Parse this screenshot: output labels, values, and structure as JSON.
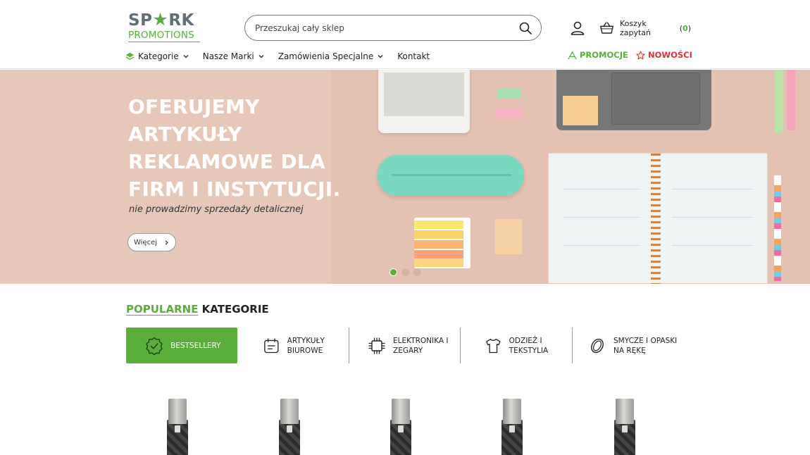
{
  "brand": {
    "logo_top_left": "SP",
    "logo_star": "★",
    "logo_top_right": "RK",
    "logo_bottom": "PROMOTIONS"
  },
  "search": {
    "placeholder": "Przeszukaj cały sklep"
  },
  "cart": {
    "label": "Koszyk zapytań",
    "count": "0"
  },
  "nav": {
    "items": [
      {
        "label": "Kategorie",
        "icon": "layers-icon"
      },
      {
        "label": "Nasze Marki"
      },
      {
        "label": "Zamówienia Specjalne"
      },
      {
        "label": "Kontakt"
      }
    ],
    "promo_label": "PROMOCJE",
    "new_label": "NOWOŚCI"
  },
  "hero": {
    "title_lines": [
      "OFERUJEMY",
      "ARTYKUŁY",
      "REKLAMOWE DLA",
      "FIRM I INSTYTUCJI."
    ],
    "subtitle": "nie prowadzimy sprzedaży detalicznej",
    "more_label": "Więcej",
    "slides_total": 3,
    "active_slide": 1
  },
  "categories": {
    "heading_green": "POPULARNE",
    "heading_dark": "KATEGORIE",
    "tabs": [
      {
        "label": "BESTSELLERY",
        "icon": "badge-check-icon",
        "active": true
      },
      {
        "label": "ARTYKUŁY BIUROWE",
        "icon": "document-icon",
        "active": false
      },
      {
        "label": "ELEKTRONIKA I ZEGARY",
        "icon": "chip-icon",
        "active": false
      },
      {
        "label": "ODZIEŻ I TEKSTYLIA",
        "icon": "tshirt-icon",
        "active": false
      },
      {
        "label": "SMYCZE I OPASKI NA RĘKĘ",
        "icon": "wristband-icon",
        "active": false
      }
    ]
  },
  "products": {
    "items": [
      {
        "icon": "usb-drive"
      },
      {
        "icon": "usb-drive"
      },
      {
        "icon": "usb-drive"
      },
      {
        "icon": "usb-drive"
      },
      {
        "icon": "usb-drive"
      }
    ]
  },
  "colors": {
    "accent_green": "#5aae3c",
    "accent_red": "#e0313c",
    "hero_bg": "#e7c7b7"
  }
}
